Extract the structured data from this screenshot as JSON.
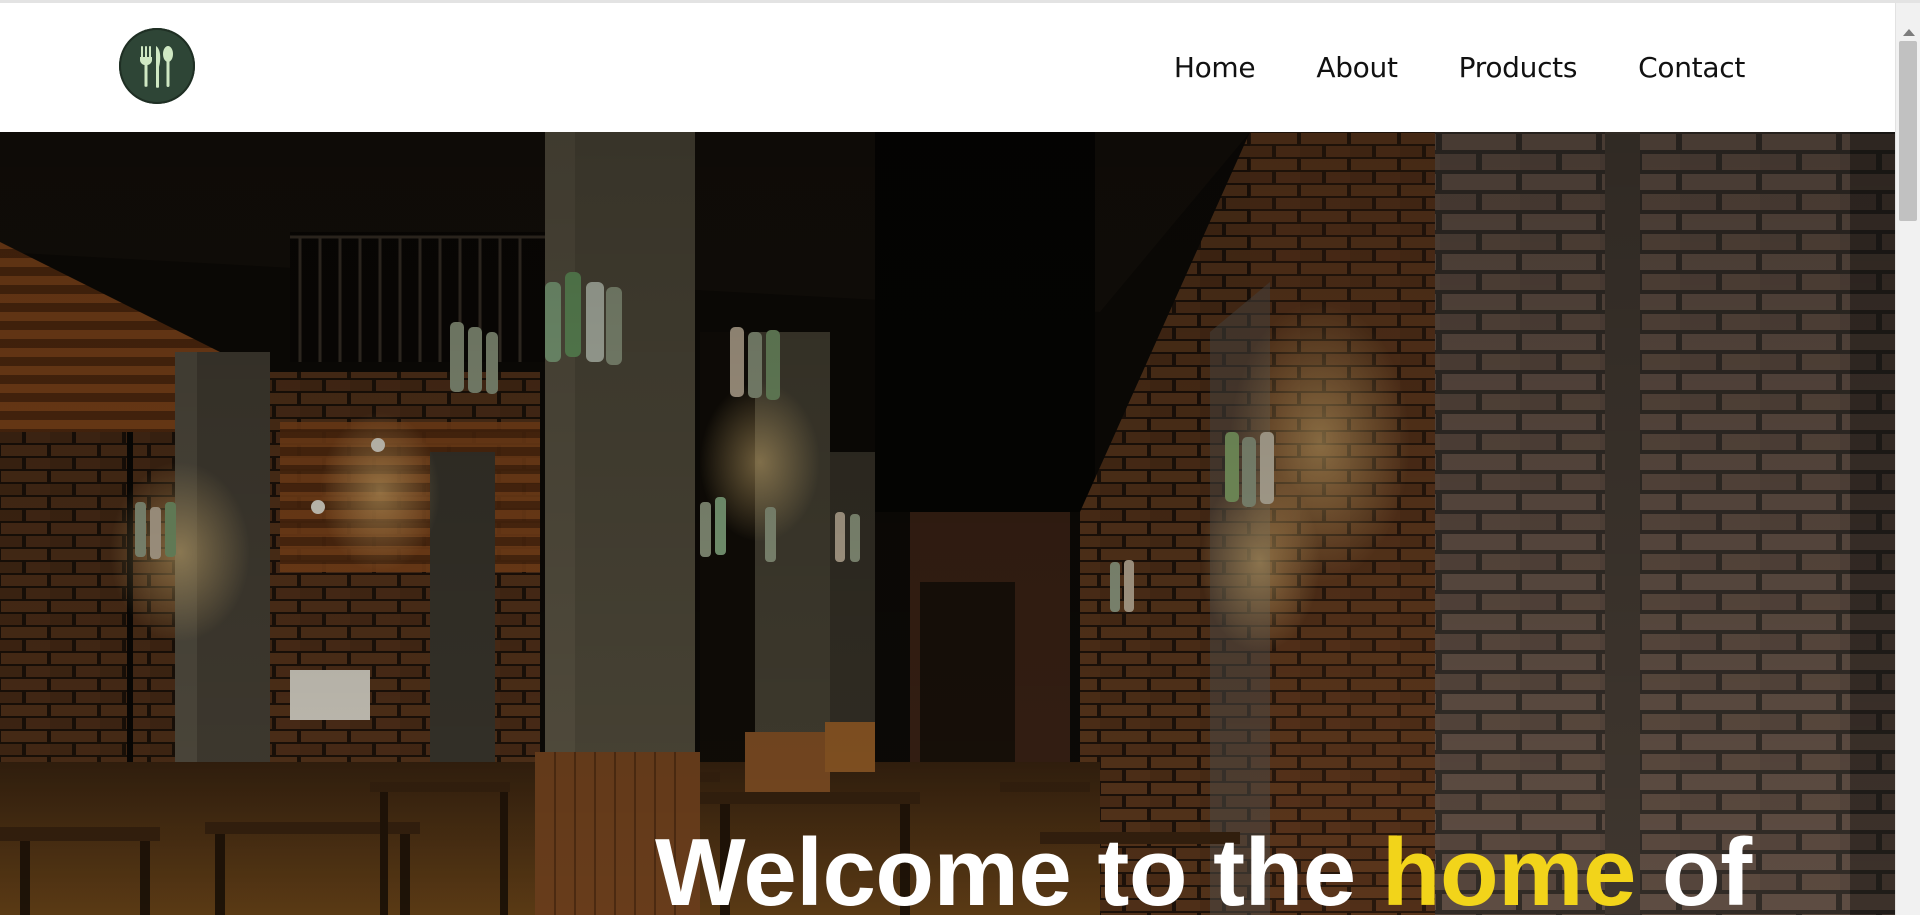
{
  "header": {
    "logo": {
      "icon": "cutlery-icon",
      "bg_color": "#2e4536",
      "icon_color": "#cfe8c3"
    },
    "nav": [
      {
        "label": "Home"
      },
      {
        "label": "About"
      },
      {
        "label": "Products"
      },
      {
        "label": "Contact"
      }
    ]
  },
  "hero": {
    "title_part1": "Welcome to the ",
    "title_accent": "home",
    "title_part2": " of",
    "accent_color": "#f2d41a",
    "background": "restaurant-bar-interior-image"
  }
}
